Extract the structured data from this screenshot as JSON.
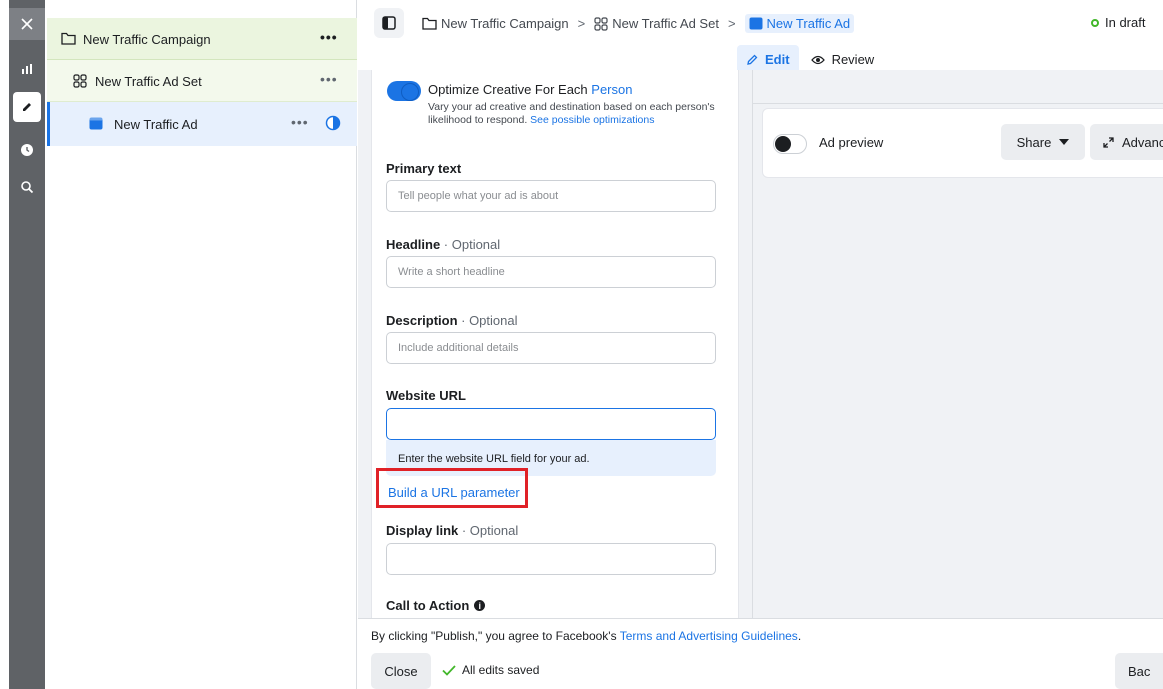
{
  "rail": {
    "icons": [
      "close-icon",
      "chart-icon",
      "pencil-icon",
      "clock-icon",
      "search-icon"
    ]
  },
  "tree": {
    "campaign_label": "New Traffic Campaign",
    "adset_label": "New Traffic Ad Set",
    "ad_label": "New Traffic Ad",
    "more": "•••"
  },
  "header": {
    "breadcrumbs": [
      "New Traffic Campaign",
      "New Traffic Ad Set",
      "New Traffic Ad"
    ],
    "separator": ">",
    "status": "In draft"
  },
  "tabs": {
    "edit": "Edit",
    "review": "Review"
  },
  "form": {
    "optimize_title_prefix": "Optimize Creative For Each ",
    "optimize_title_link": "Person",
    "optimize_desc": "Vary your ad creative and destination based on each person's likelihood to respond. ",
    "optimize_desc_link": "See possible optimizations",
    "primary_text_label": "Primary text",
    "primary_text_placeholder": "Tell people what your ad is about",
    "headline_label": "Headline",
    "headline_optional": " · Optional",
    "headline_placeholder": "Write a short headline",
    "description_label": "Description",
    "description_optional": " · Optional",
    "description_placeholder": "Include additional details",
    "website_url_label": "Website URL",
    "website_url_value": "",
    "website_url_hint": "Enter the website URL field for your ad.",
    "build_url_link": "Build a URL parameter",
    "display_link_label": "Display link",
    "display_link_optional": " · Optional",
    "display_link_value": "",
    "cta_label": "Call to Action"
  },
  "preview": {
    "toggle_label": "Ad preview",
    "share": "Share",
    "advanced": "Advanc"
  },
  "footer": {
    "terms_prefix": "By clicking \"Publish,\" you agree to Facebook's ",
    "terms_link": "Terms and Advertising Guidelines",
    "terms_suffix": ".",
    "close": "Close",
    "saved": "All edits saved",
    "back": "Bac"
  },
  "colors": {
    "accent": "#1b74e4",
    "status_green": "#42b72a",
    "highlight_red": "#e02127"
  }
}
